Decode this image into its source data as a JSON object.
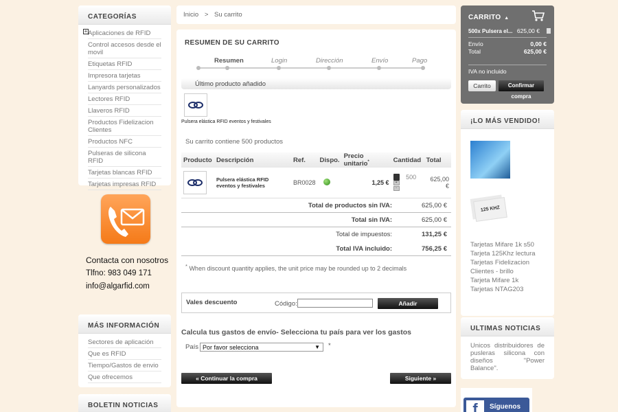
{
  "categories": {
    "title": "CATEGORÍAS",
    "items": [
      "Aplicaciones de RFID",
      "Control accesos desde el movil",
      "Etiquetas RFID",
      "Impresora tarjetas",
      "Lanyards personalizados",
      "Lectores RFID",
      "Llaveros RFID",
      "Productos Fidelizacion Clientes",
      "Productos NFC",
      "Pulseras de silicona RFID",
      "Tarjetas blancas RFID",
      "Tarjetas impresas RFID"
    ]
  },
  "contact": {
    "title": "Contacta con nosotros",
    "phone": "Tlfno: 983 049 171",
    "email": "info@algarfid.com"
  },
  "more_info": {
    "title": "MÁS INFORMACIÓN",
    "items": [
      "Sectores de aplicación",
      "Que es RFID",
      "Tiempo/Gastos de envio",
      "Que ofrecemos"
    ]
  },
  "newsletter": {
    "title": "BOLETIN NOTICIAS"
  },
  "breadcrumb": {
    "home": "Inicio",
    "sep": ">",
    "current": "Su carrito"
  },
  "summary": {
    "title": "RESUMEN DE SU CARRITO",
    "steps": [
      "Resumen",
      "Login",
      "Dirección",
      "Envío",
      "Pago"
    ],
    "last_added_title": "Último producto añadido",
    "last_added_name": "Pulsera elástica RFID eventos y festivales",
    "contains": "Su carrito contiene 500 productos"
  },
  "table": {
    "headers": {
      "product": "Producto",
      "description": "Descripción",
      "ref": "Ref.",
      "availability": "Dispo.",
      "unit_price": "Precio unitario",
      "unit_price_mark": "*",
      "quantity": "Cantidad",
      "total": "Total"
    },
    "row": {
      "description": "Pulsera elástica RFID eventos y festivales",
      "ref": "BR0028",
      "unit_price": "1,25 €",
      "quantity": "500",
      "total": "625,00 €",
      "up": "+",
      "down": "-"
    }
  },
  "totals": [
    {
      "label": "Total de productos sin IVA:",
      "value": "625,00 €"
    },
    {
      "label": "Total sin IVA:",
      "value": "625,00 €"
    },
    {
      "label": "Total de impuestos:",
      "value": "131,25 €"
    },
    {
      "label": "Total IVA incluido:",
      "value": "756,25 €"
    }
  ],
  "note": {
    "mark": "*",
    "text": "When discount quantity applies, the unit price may be rounded up to 2 decimals"
  },
  "voucher": {
    "title": "Vales descuento",
    "code_label": "Código:",
    "code_value": "",
    "add_button": "Añadir"
  },
  "shipping": {
    "title": "Calcula tus gastos de envío- Selecciona tu país para ver los gastos",
    "country_label": "País",
    "country_selected": "Por favor selecciona",
    "country_mark": "*"
  },
  "nav": {
    "back": "« Continuar la compra",
    "next": "Siguiente »"
  },
  "mini_cart": {
    "title": "CARRITO",
    "item_name": "500x Pulsera el...",
    "item_price": "625,00 €",
    "shipping_label": "Envío",
    "shipping_value": "0,00 €",
    "total_label": "Total",
    "total_value": "625,00 €",
    "vat_note": "IVA no incluido",
    "cart_button": "Carrito",
    "checkout_button": "Confirmar compra"
  },
  "best_sellers": {
    "title": "¡LO MÁS VENDIDO!",
    "card_label": "125 KHZ",
    "items": [
      "Tarjetas Mifare 1k s50",
      "Tarjeta 125Khz lectura",
      "Tarjetas Fidelizacion Clientes - brillo",
      "Tarjeta Mifare 1k",
      "Tarjetas NTAG203"
    ]
  },
  "news": {
    "title": "ULTIMAS NOTICIAS",
    "text": "Unicos distribuidores de pusleras silicona con diseños \"Power Balance\"."
  },
  "facebook": {
    "label": "Síguenos en"
  }
}
